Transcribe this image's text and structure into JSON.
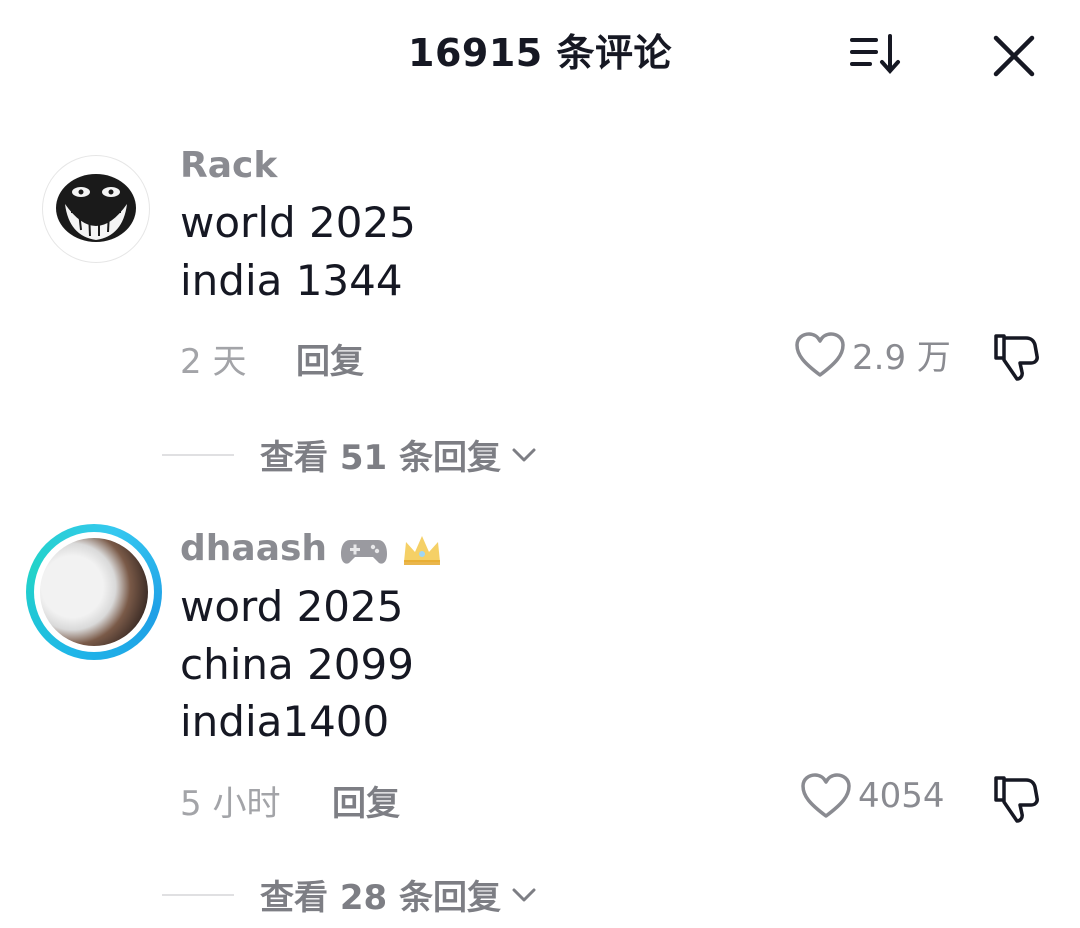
{
  "header": {
    "title": "16915 条评论",
    "sort_icon": "sort-icon",
    "close_icon": "close-icon"
  },
  "comments": [
    {
      "username": "Rack",
      "lines": [
        "world 2025",
        "india 1344"
      ],
      "time": "2 天",
      "reply_label": "回复",
      "likes": "2.9 万",
      "view_replies": "查看 51 条回复",
      "avatar": "troll-face-avatar"
    },
    {
      "username": "dhaash",
      "username_badges": [
        "gamepad-emoji",
        "crown-emoji"
      ],
      "lines": [
        "word 2025",
        "china 2099",
        "india1400"
      ],
      "time": "5 小时",
      "reply_label": "回复",
      "likes": "4054",
      "view_replies": "查看 28 条回复",
      "avatar": "photo-avatar",
      "avatar_ring_color": "#1fb6e8"
    }
  ]
}
